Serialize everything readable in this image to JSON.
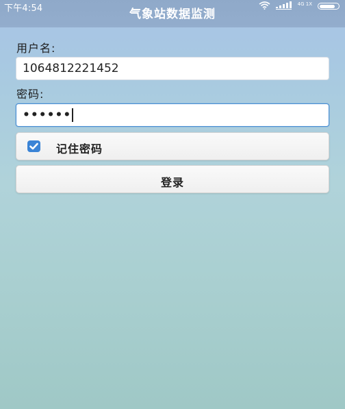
{
  "status_bar": {
    "time": "下午4:54",
    "signal_text": "4G 1X",
    "icons": [
      "wifi-icon",
      "signal-icon",
      "battery-icon"
    ]
  },
  "app": {
    "title": "气象站数据监测"
  },
  "login_form": {
    "username_label": "用户名:",
    "username_value": "1064812221452",
    "password_label": "密码:",
    "password_value": "••••••",
    "remember_label": "记住密码",
    "remember_checked": true,
    "login_button": "登录"
  },
  "colors": {
    "accent": "#3b84d6",
    "status_bar": "#8fa9c9",
    "focus_border": "#4a8fd4"
  }
}
